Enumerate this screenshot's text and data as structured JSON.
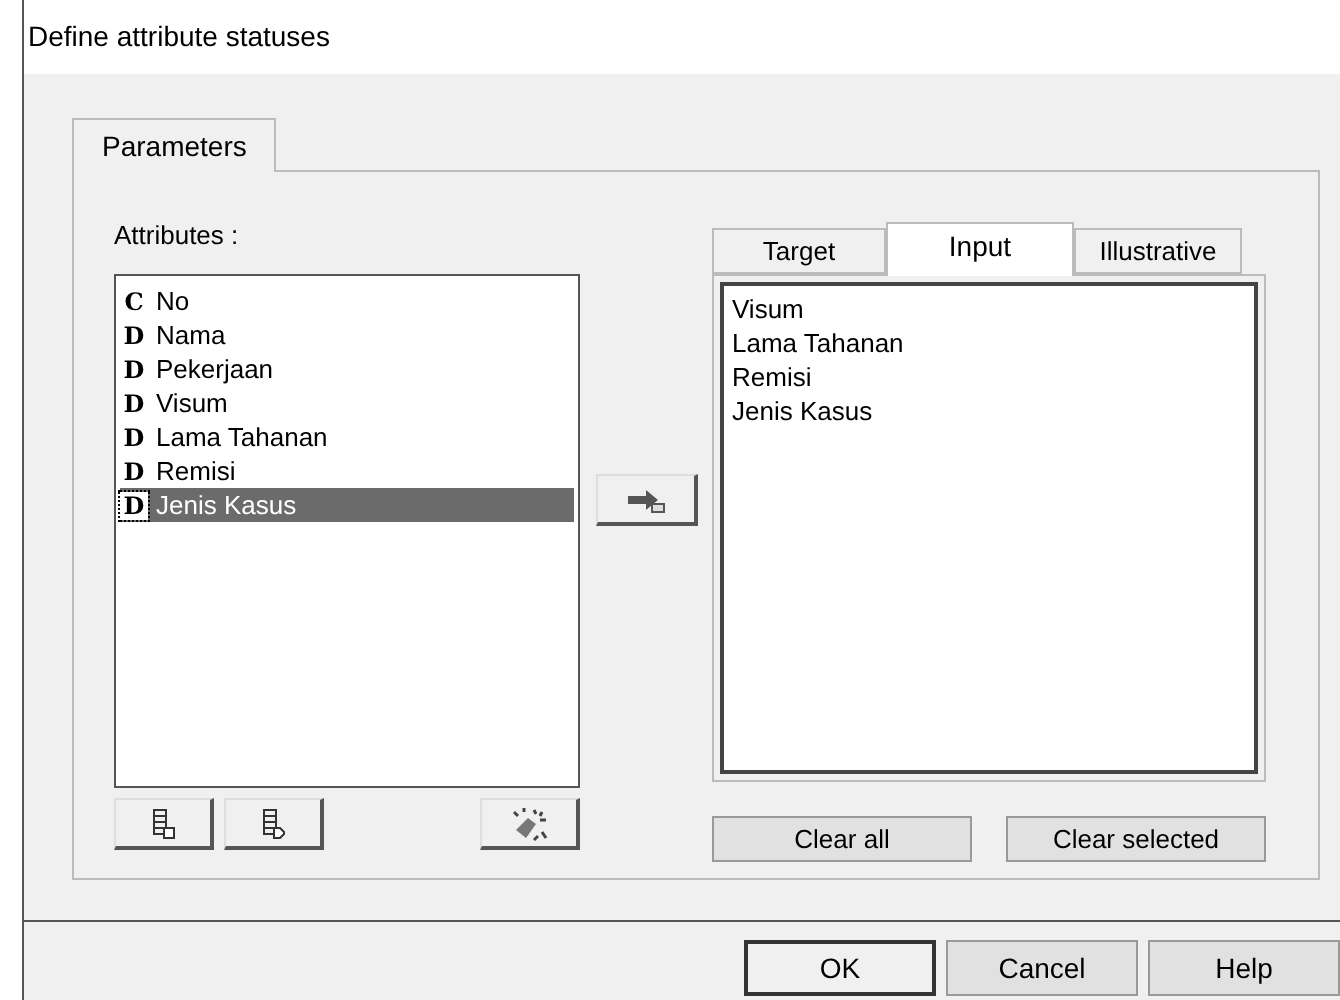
{
  "window": {
    "title": "Define attribute statuses"
  },
  "tabs": [
    {
      "label": "Parameters",
      "selected": true
    }
  ],
  "attributes": {
    "label": "Attributes :",
    "items": [
      {
        "type": "C",
        "name": "No",
        "selected": false
      },
      {
        "type": "D",
        "name": "Nama",
        "selected": false
      },
      {
        "type": "D",
        "name": "Pekerjaan",
        "selected": false
      },
      {
        "type": "D",
        "name": "Visum",
        "selected": false
      },
      {
        "type": "D",
        "name": "Lama Tahanan",
        "selected": false
      },
      {
        "type": "D",
        "name": "Remisi",
        "selected": false
      },
      {
        "type": "D",
        "name": "Jenis Kasus",
        "selected": true
      }
    ]
  },
  "status_tabs": [
    {
      "label": "Target",
      "selected": false
    },
    {
      "label": "Input",
      "selected": true
    },
    {
      "label": "Illustrative",
      "selected": false
    }
  ],
  "status_items": [
    "Visum",
    "Lama Tahanan",
    "Remisi",
    "Jenis Kasus"
  ],
  "list_buttons": [
    "Clear all",
    "Clear selected"
  ],
  "buttons": [
    "OK",
    "Cancel",
    "Help"
  ]
}
